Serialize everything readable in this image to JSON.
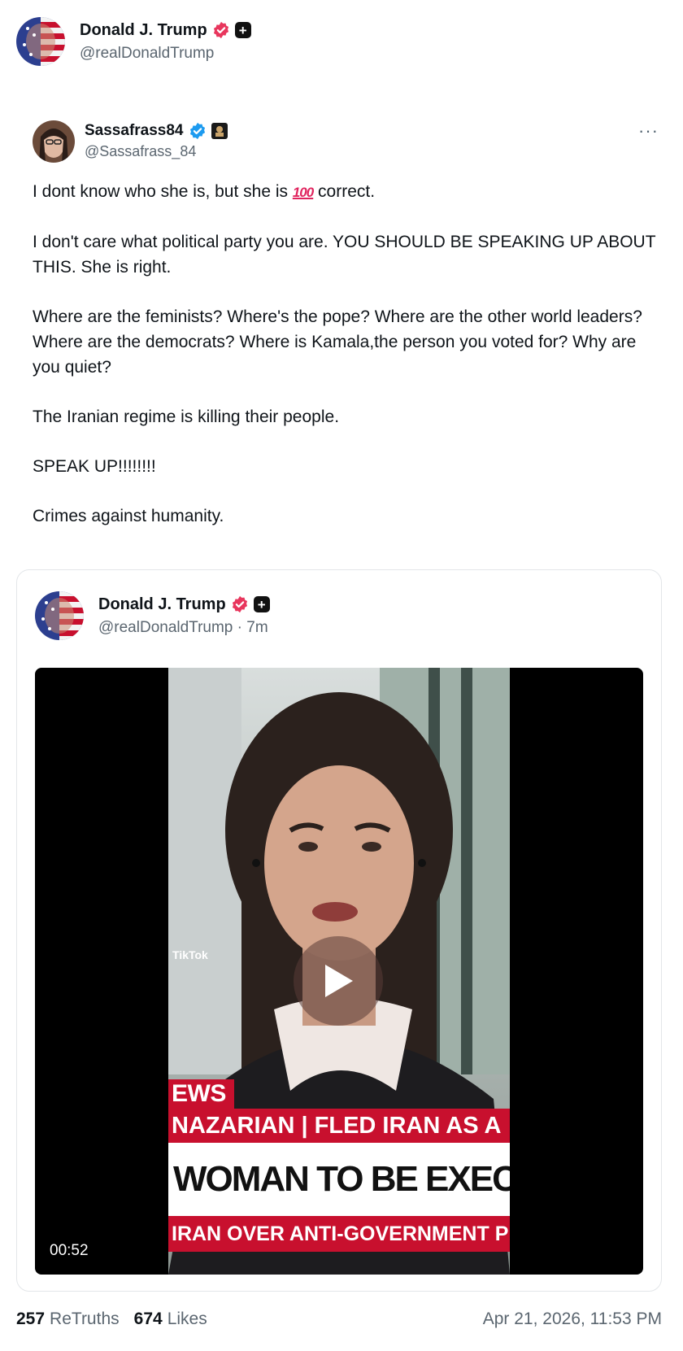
{
  "post": {
    "author": {
      "name": "Donald J. Trump",
      "handle": "@realDonaldTrump"
    },
    "retruth": {
      "author": {
        "name": "Sassafrass84",
        "handle": "@Sassafrass_84"
      },
      "more_label": "···",
      "paragraphs": {
        "p1_before": "I dont know who she is, but she is ",
        "p1_emoji": "100",
        "p1_after": " correct.",
        "p2": "I don't care what political party you are. YOU SHOULD BE SPEAKING UP ABOUT THIS. She is right.",
        "p3": "Where are the feminists? Where's the pope? Where are the other world leaders? Where are the democrats? Where is Kamala,the person you voted for? Why are you quiet?",
        "p4": "The Iranian regime is killing their people.",
        "p5": "SPEAK UP!!!!!!!!",
        "p6": "Crimes against humanity."
      }
    },
    "quoted": {
      "author": {
        "name": "Donald J. Trump",
        "handle": "@realDonaldTrump · 7m"
      },
      "video": {
        "duration": "00:52",
        "watermark": "TikTok",
        "lower_third": {
          "tag": "EWS",
          "name_line": "NAZARIAN | FLED IRAN AS A",
          "headline": "WOMAN TO BE EXECUTED FOR",
          "subline": "IRAN OVER ANTI-GOVERNMENT PRO"
        }
      }
    },
    "stats": {
      "retruths_count": "257",
      "retruths_label": "ReTruths",
      "likes_count": "674",
      "likes_label": "Likes",
      "timestamp": "Apr 21, 2026, 11:53 PM"
    }
  },
  "colors": {
    "verified_badge": "#e8365d",
    "verified_blue": "#1d9bf0",
    "news_red": "#c8102e"
  }
}
